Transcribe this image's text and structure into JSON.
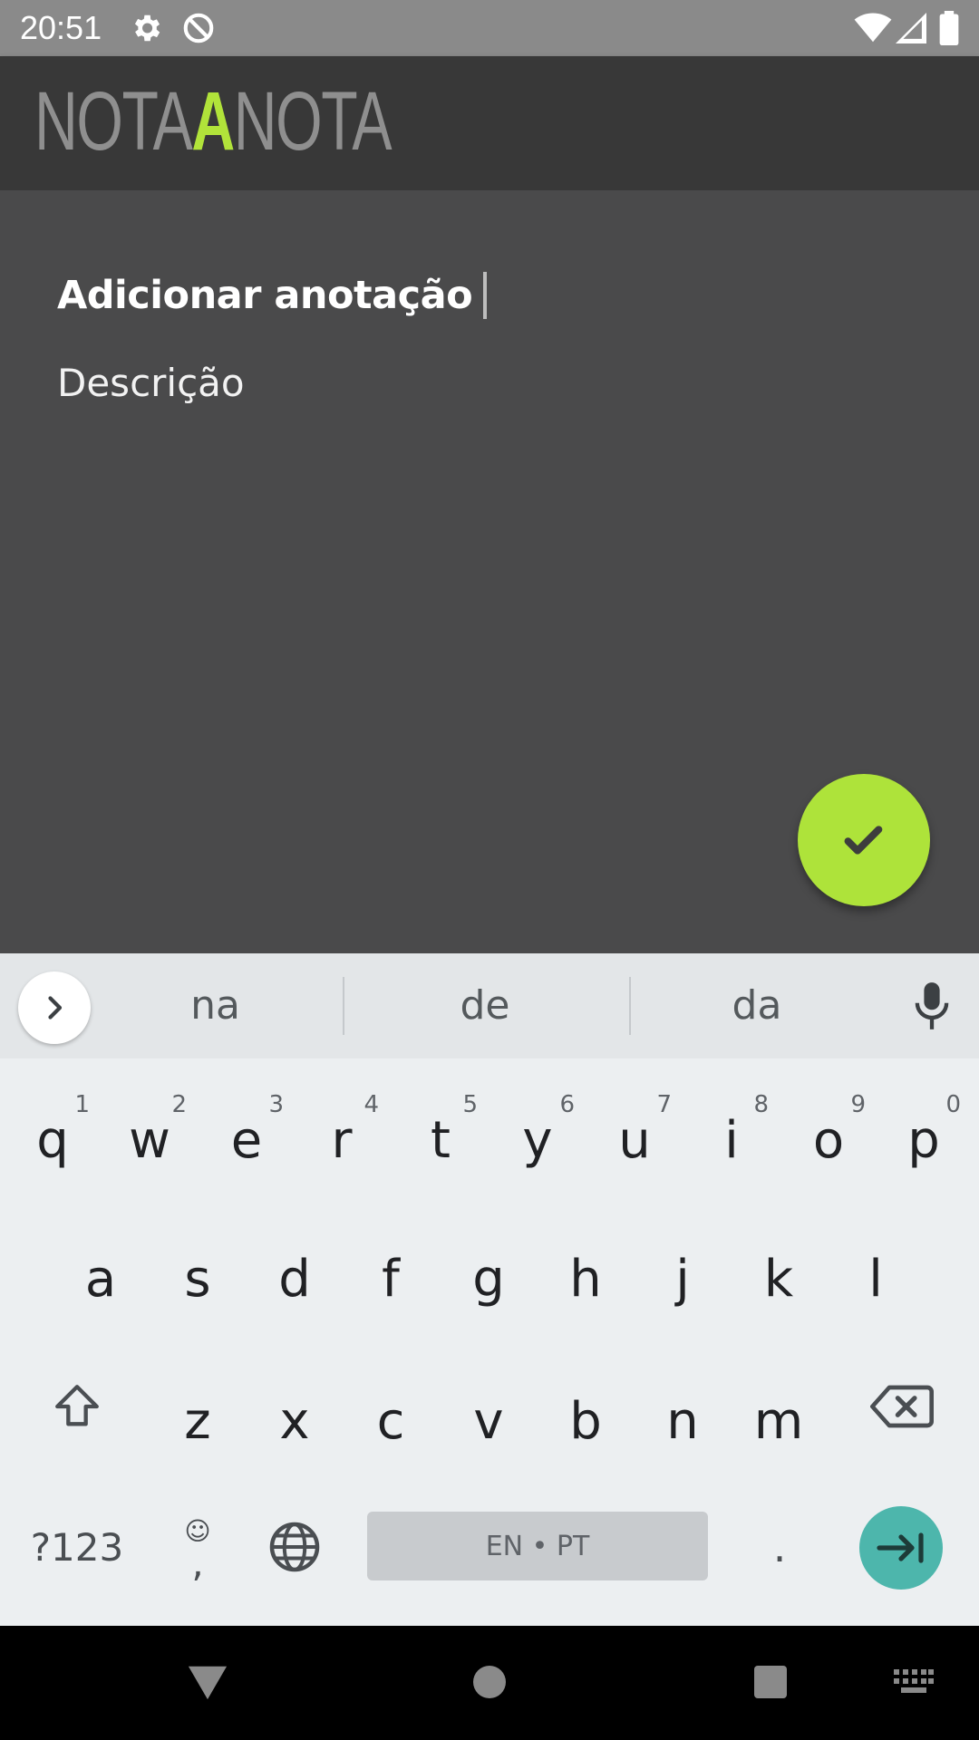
{
  "status_bar": {
    "time": "20:51"
  },
  "app": {
    "logo_part1": "NOTA",
    "logo_accent": "A",
    "logo_part2": "NOTA",
    "accent_color": "#b1e33a"
  },
  "form": {
    "title_placeholder": "Adicionar anotação",
    "description_placeholder": "Descrição"
  },
  "keyboard": {
    "suggestions": [
      "na",
      "de",
      "da"
    ],
    "row1": [
      {
        "letter": "q",
        "hint": "1"
      },
      {
        "letter": "w",
        "hint": "2"
      },
      {
        "letter": "e",
        "hint": "3"
      },
      {
        "letter": "r",
        "hint": "4"
      },
      {
        "letter": "t",
        "hint": "5"
      },
      {
        "letter": "y",
        "hint": "6"
      },
      {
        "letter": "u",
        "hint": "7"
      },
      {
        "letter": "i",
        "hint": "8"
      },
      {
        "letter": "o",
        "hint": "9"
      },
      {
        "letter": "p",
        "hint": "0"
      }
    ],
    "row2": [
      "a",
      "s",
      "d",
      "f",
      "g",
      "h",
      "j",
      "k",
      "l"
    ],
    "row3": [
      "z",
      "x",
      "c",
      "v",
      "b",
      "n",
      "m"
    ],
    "symbols_label": "?123",
    "comma_label": ",",
    "emoji_label": "☺",
    "space_label": "EN • PT",
    "period_label": "."
  }
}
